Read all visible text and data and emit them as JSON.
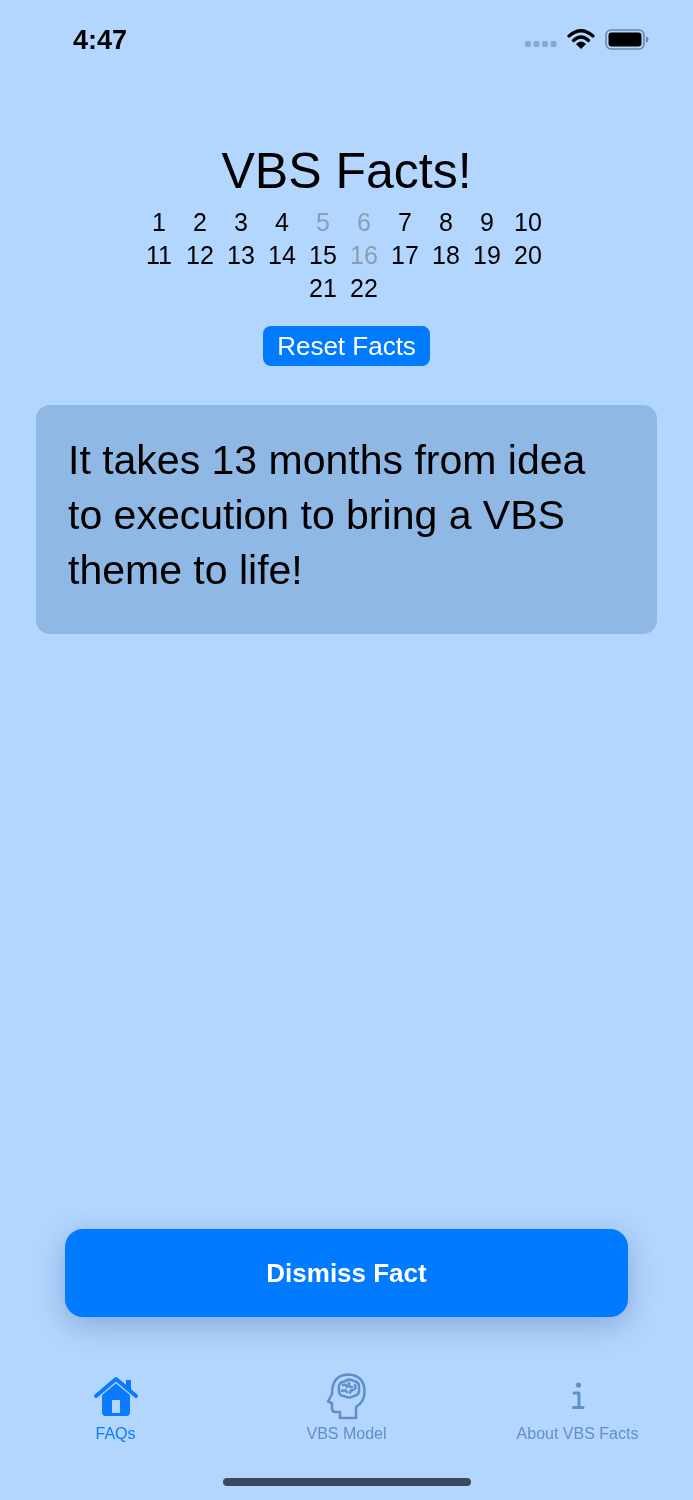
{
  "status_bar": {
    "time": "4:47"
  },
  "title": "VBS Facts!",
  "fact_numbers": [
    {
      "label": "1",
      "disabled": false
    },
    {
      "label": "2",
      "disabled": false
    },
    {
      "label": "3",
      "disabled": false
    },
    {
      "label": "4",
      "disabled": false
    },
    {
      "label": "5",
      "disabled": true
    },
    {
      "label": "6",
      "disabled": true
    },
    {
      "label": "7",
      "disabled": false
    },
    {
      "label": "8",
      "disabled": false
    },
    {
      "label": "9",
      "disabled": false
    },
    {
      "label": "10",
      "disabled": false
    },
    {
      "label": "11",
      "disabled": false
    },
    {
      "label": "12",
      "disabled": false
    },
    {
      "label": "13",
      "disabled": false
    },
    {
      "label": "14",
      "disabled": false
    },
    {
      "label": "15",
      "disabled": false
    },
    {
      "label": "16",
      "disabled": true
    },
    {
      "label": "17",
      "disabled": false
    },
    {
      "label": "18",
      "disabled": false
    },
    {
      "label": "19",
      "disabled": false
    },
    {
      "label": "20",
      "disabled": false
    },
    {
      "label": "21",
      "disabled": false
    },
    {
      "label": "22",
      "disabled": false
    }
  ],
  "reset_button": "Reset Facts",
  "fact_card": {
    "text": "It takes 13 months from idea to execution to bring a VBS theme to life!"
  },
  "dismiss_button": "Dismiss Fact",
  "tab_bar": [
    {
      "label": "FAQs",
      "selected": true
    },
    {
      "label": "VBS Model",
      "selected": false
    },
    {
      "label": "About VBS Facts",
      "selected": false
    }
  ]
}
